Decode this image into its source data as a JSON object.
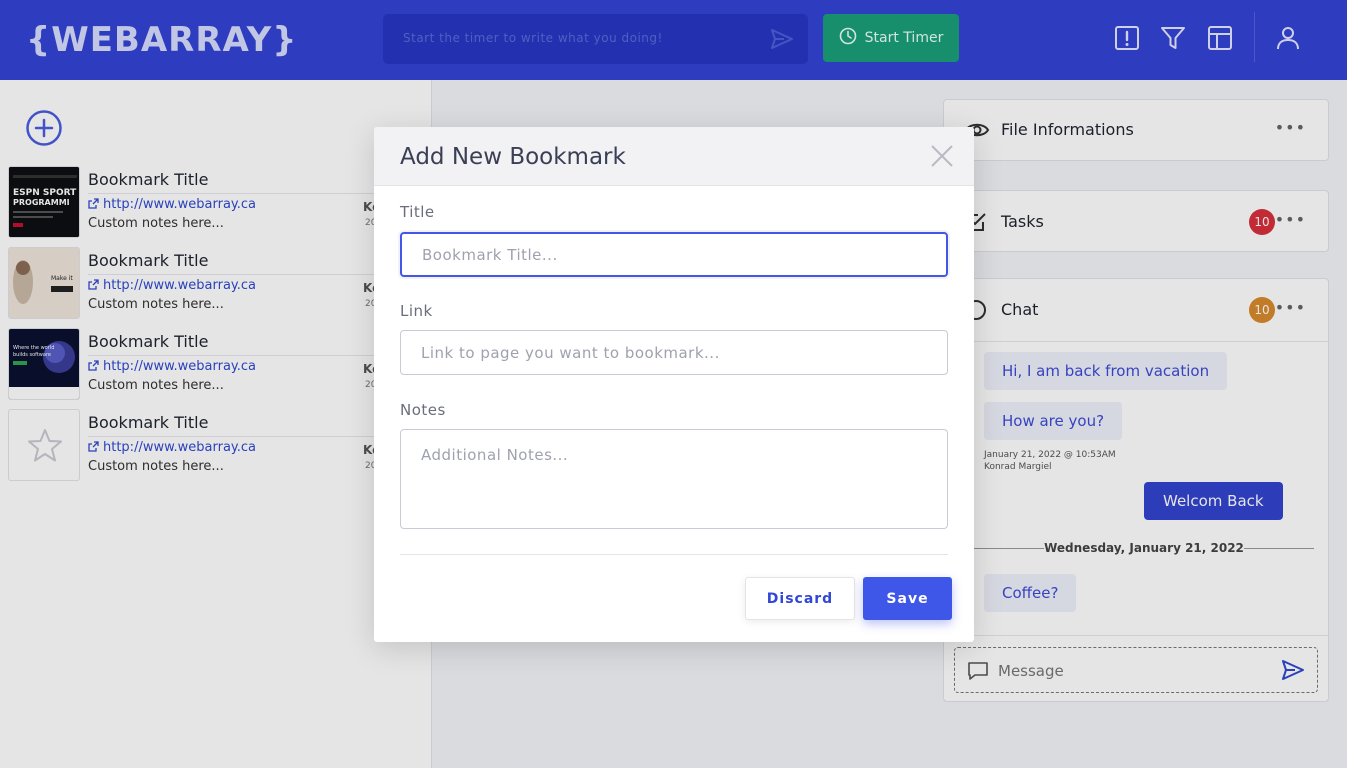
{
  "app": {
    "logo": "{WEBARRAY}"
  },
  "header": {
    "timer_placeholder": "Start the timer to write what you doing!",
    "start_timer_label": "Start Timer"
  },
  "bookmarks": [
    {
      "title": "Bookmark Title",
      "link": "http://www.webarray.ca",
      "notes": "Custom notes here...",
      "owner_initial": "Ke",
      "year_fragment": "20",
      "thumb": "espn-sports"
    },
    {
      "title": "Bookmark Title",
      "link": "http://www.webarray.ca",
      "notes": "Custom notes here...",
      "owner_initial": "Ke",
      "year_fragment": "20",
      "thumb": "make-it"
    },
    {
      "title": "Bookmark Title",
      "link": "http://www.webarray.ca",
      "notes": "Custom notes here...",
      "owner_initial": "Ke",
      "year_fragment": "20",
      "thumb": "planet"
    },
    {
      "title": "Bookmark Title",
      "link": "http://www.webarray.ca",
      "notes": "Custom notes here...",
      "owner_initial": "Ke",
      "year_fragment": "20",
      "thumb": "star-icon"
    }
  ],
  "right_panel": {
    "file_info_title": "File Informations",
    "tasks_title": "Tasks",
    "tasks_count": "10",
    "chat_title": "Chat",
    "chat_count": "10",
    "messages": [
      {
        "text": "Hi, I am back from vacation",
        "direction": "in"
      },
      {
        "text": "How are you?",
        "direction": "in"
      },
      {
        "text": "Welcom Back",
        "direction": "out"
      },
      {
        "text": "Coffee?",
        "direction": "in"
      }
    ],
    "message_timestamp": "January 21, 2022 @ 10:53AM",
    "message_author": "Konrad Margiel",
    "date_separator": "Wednesday, January 21, 2022",
    "message_placeholder": "Message"
  },
  "modal": {
    "title": "Add New Bookmark",
    "title_label": "Title",
    "title_placeholder": "Bookmark Title...",
    "link_label": "Link",
    "link_placeholder": "Link to page you want to bookmark...",
    "notes_label": "Notes",
    "notes_placeholder": "Additional Notes...",
    "discard_label": "Discard",
    "save_label": "Save"
  },
  "colors": {
    "header_bg": "#3445d6",
    "primary": "#3e57e8",
    "start_timer": "#1aa07a",
    "tasks_badge": "#d9303b",
    "chat_badge": "#d9892c"
  }
}
